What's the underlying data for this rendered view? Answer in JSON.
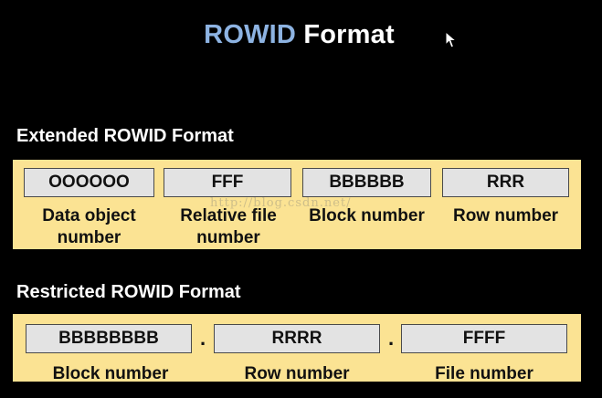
{
  "title": {
    "part1": "ROWID",
    "part2": "Format"
  },
  "extended": {
    "heading": "Extended ROWID Format",
    "fields": [
      {
        "value": "OOOOOO",
        "label": "Data object number"
      },
      {
        "value": "FFF",
        "label": "Relative file number"
      },
      {
        "value": "BBBBBB",
        "label": "Block number"
      },
      {
        "value": "RRR",
        "label": "Row number"
      }
    ]
  },
  "restricted": {
    "heading": "Restricted ROWID Format",
    "separator": ".",
    "fields": [
      {
        "value": "BBBBBBBB",
        "label": "Block number"
      },
      {
        "value": "RRRR",
        "label": "Row number"
      },
      {
        "value": "FFFF",
        "label": "File number"
      }
    ]
  },
  "watermark": "http://blog.csdn.net/",
  "icons": {
    "cursor": "arrow-cursor-icon"
  },
  "colors": {
    "background": "#000000",
    "band": "#fbe393",
    "field": "#e3e3e3",
    "title_accent": "#8db3e2"
  }
}
